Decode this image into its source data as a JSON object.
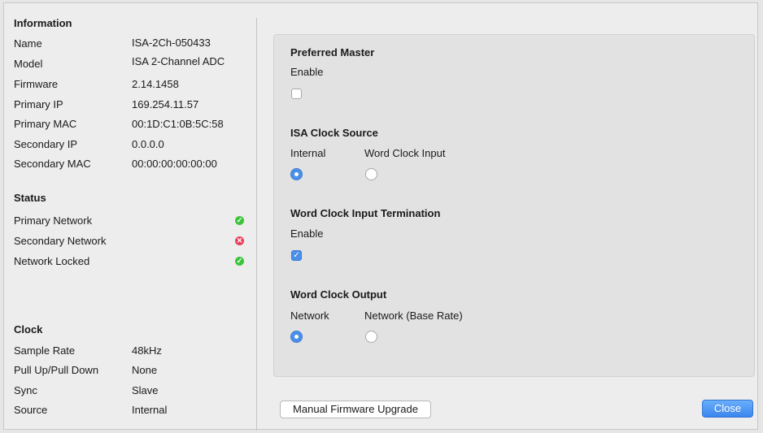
{
  "information": {
    "title": "Information",
    "rows": [
      {
        "label": "Name",
        "value": "ISA-2Ch-050433"
      },
      {
        "label": "Model",
        "value": "ISA 2-Channel ADC"
      },
      {
        "label": "Firmware",
        "value": "2.14.1458"
      },
      {
        "label": "Primary IP",
        "value": "169.254.11.57"
      },
      {
        "label": "Primary MAC",
        "value": "00:1D:C1:0B:5C:58"
      },
      {
        "label": "Secondary IP",
        "value": "0.0.0.0"
      },
      {
        "label": "Secondary MAC",
        "value": "00:00:00:00:00:00"
      }
    ]
  },
  "status": {
    "title": "Status",
    "rows": [
      {
        "label": "Primary Network",
        "state": "ok",
        "icon": "check-icon",
        "color": "#3cc43a"
      },
      {
        "label": "Secondary Network",
        "state": "error",
        "icon": "cross-icon",
        "color": "#e8425a"
      },
      {
        "label": "Network Locked",
        "state": "ok",
        "icon": "check-icon",
        "color": "#3cc43a"
      }
    ]
  },
  "clock": {
    "title": "Clock",
    "rows": [
      {
        "label": "Sample Rate",
        "value": "48kHz"
      },
      {
        "label": "Pull Up/Pull Down",
        "value": "None"
      },
      {
        "label": "Sync",
        "value": "Slave"
      },
      {
        "label": "Source",
        "value": "Internal"
      }
    ]
  },
  "settings": {
    "preferred_master": {
      "title": "Preferred Master",
      "label": "Enable",
      "checked": false
    },
    "clock_source": {
      "title": "ISA  Clock Source",
      "options": [
        {
          "label": "Internal",
          "selected": true
        },
        {
          "label": "Word Clock Input",
          "selected": false
        }
      ]
    },
    "wc_termination": {
      "title": "Word Clock Input Termination",
      "label": "Enable",
      "checked": true
    },
    "wc_output": {
      "title": "Word Clock Output",
      "options": [
        {
          "label": "Network",
          "selected": true
        },
        {
          "label": "Network (Base Rate)",
          "selected": false
        }
      ]
    }
  },
  "buttons": {
    "firmware": "Manual Firmware Upgrade",
    "close": "Close"
  },
  "colors": {
    "accent": "#4a90e8",
    "ok": "#3cc43a",
    "error": "#e8425a"
  }
}
